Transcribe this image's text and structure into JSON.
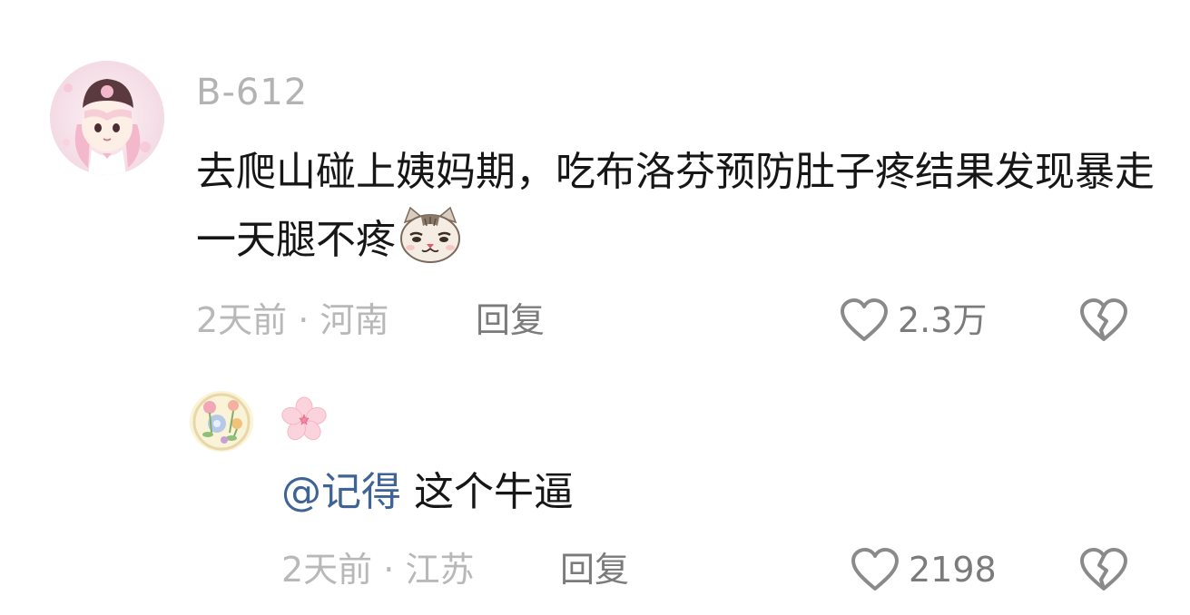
{
  "comment": {
    "username": "B-612",
    "text": "去爬山碰上姨妈期，吃布洛芬预防肚子疼结果发现暴走一天腿不疼",
    "emoji": "cat-face-emoji",
    "time": "2天前",
    "separator": "·",
    "location": "河南",
    "reply_label": "回复",
    "like_count": "2.3万",
    "like_icon": "heart-outline-icon",
    "dislike_icon": "broken-heart-icon"
  },
  "reply": {
    "username_icon": "sakura-flower-icon",
    "mention": "@记得",
    "text": " 这个牛逼",
    "time": "2天前",
    "separator": "·",
    "location": "江苏",
    "reply_label": "回复",
    "like_count": "2198",
    "like_icon": "heart-outline-icon",
    "dislike_icon": "broken-heart-icon"
  },
  "colors": {
    "text_primary": "#161616",
    "text_muted": "#b8b8b8",
    "text_secondary": "#7b7b7b",
    "mention": "#3e6396",
    "icon": "#8a8a8a"
  }
}
